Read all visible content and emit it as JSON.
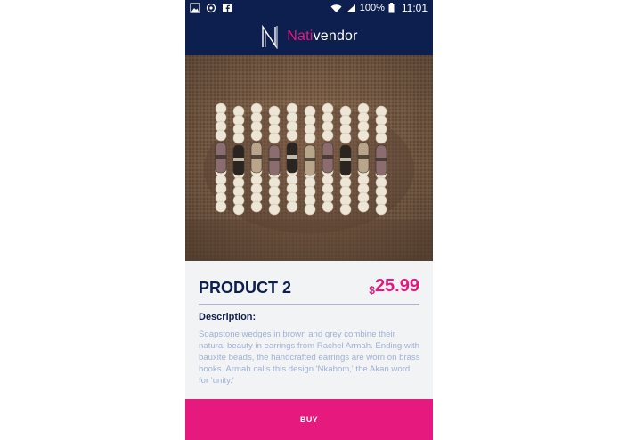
{
  "status_bar": {
    "icons": [
      "gallery-icon",
      "sync-icon",
      "facebook-icon"
    ],
    "battery": "100%",
    "time": "11:01"
  },
  "header": {
    "brand_part1": "Nati",
    "brand_part2": "vendor",
    "colors": {
      "navy": "#0d1f4f",
      "accent": "#e5197e"
    }
  },
  "product": {
    "name": "PRODUCT 2",
    "currency": "$",
    "price": "25.99",
    "description_label": "Description:",
    "description": "Soapstone wedges in brown and grey combine their natural beauty in earrings from Rachel Armah. Ending with bauxite beads, the handcrafted earrings are worn on brass hooks. Armah calls this design 'Nkabom,' the Akan word for 'unity.'"
  },
  "actions": {
    "buy_label": "BUY"
  }
}
